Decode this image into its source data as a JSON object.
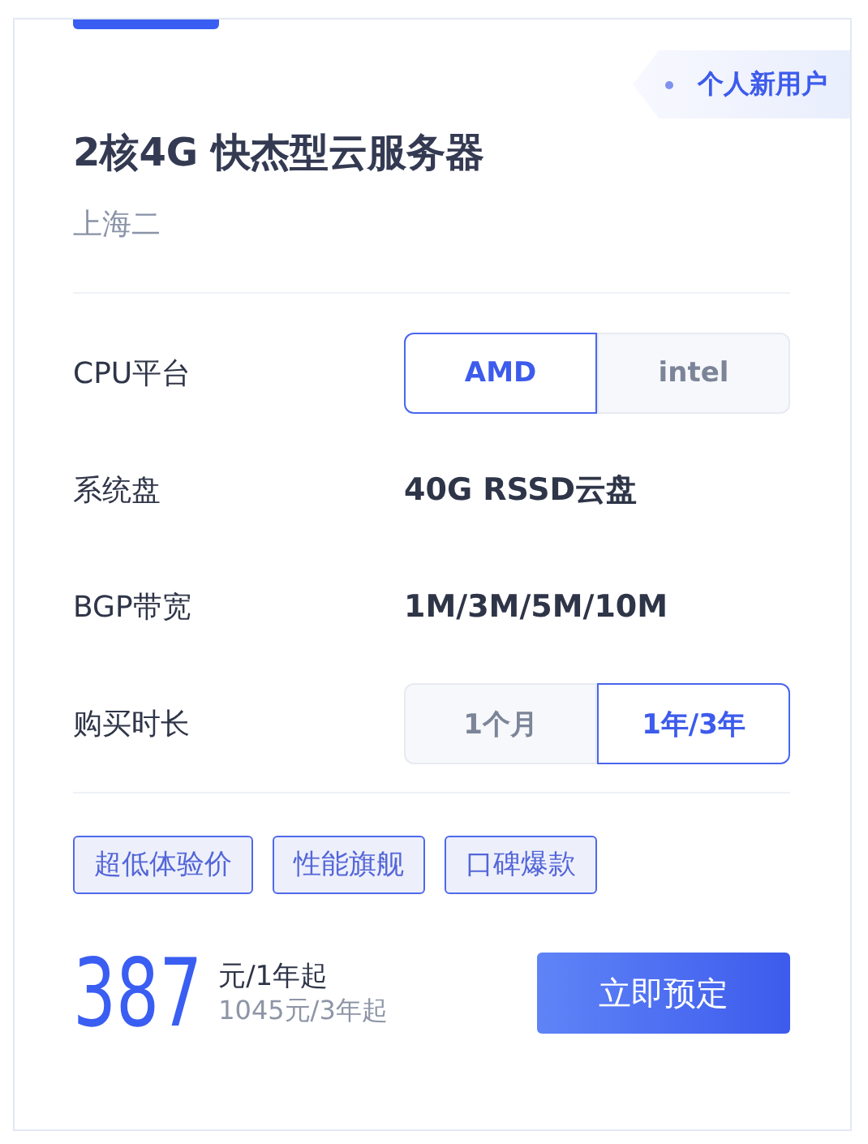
{
  "badge": "个人新用户",
  "title": "2核4G 快杰型云服务器",
  "region": "上海二",
  "specs": [
    {
      "kind": "options",
      "label": "CPU平台",
      "options": [
        {
          "label": "AMD",
          "selected": true
        },
        {
          "label": "intel",
          "selected": false
        }
      ]
    },
    {
      "kind": "text",
      "label": "系统盘",
      "value": "40G RSSD云盘"
    },
    {
      "kind": "text",
      "label": "BGP带宽",
      "value": "1M/3M/5M/10M"
    },
    {
      "kind": "options",
      "label": "购买时长",
      "options": [
        {
          "label": "1个月",
          "selected": false
        },
        {
          "label": "1年/3年",
          "selected": true
        }
      ]
    }
  ],
  "tags": [
    "超低体验价",
    "性能旗舰",
    "口碑爆款"
  ],
  "price": {
    "amount": "387",
    "unit": "元/1年起",
    "alt": "1045元/3年起"
  },
  "button": "立即预定"
}
